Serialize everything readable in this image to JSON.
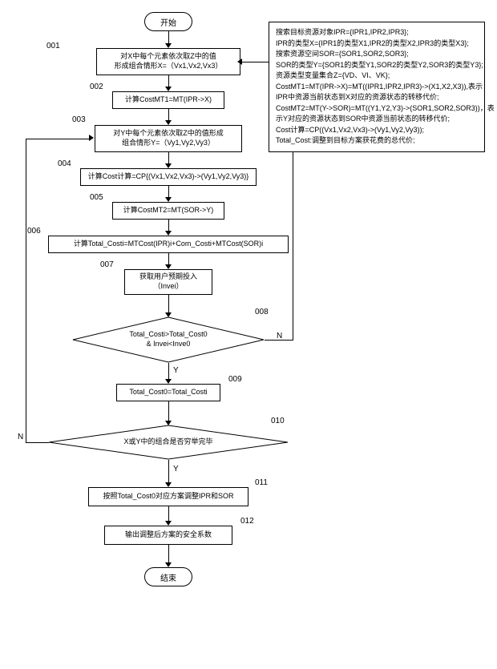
{
  "terminator": {
    "start": "开始",
    "end": "结束"
  },
  "steps": {
    "s001": {
      "num": "001",
      "text": "对X中每个元素依次取Z中的值\n形成组合情形X=（Vx1,Vx2,Vx3）"
    },
    "s002": {
      "num": "002",
      "text": "计算CostMT1=MT(IPR->X)"
    },
    "s003": {
      "num": "003",
      "text": "对Y中每个元素依次取Z中的值形成\n组合情形Y=（Vy1,Vy2,Vy3）"
    },
    "s004": {
      "num": "004",
      "text": "计算Cost计算=CP{(Vx1,Vx2,Vx3)->(Vy1,Vy2,Vy3)}"
    },
    "s005": {
      "num": "005",
      "text": "计算CostMT2=MT(SOR->Y)"
    },
    "s006": {
      "num": "006",
      "text": "计算Total_Costi=MTCost(IPR)i+Com_Costi+MTCost(SOR)i"
    },
    "s007": {
      "num": "007",
      "text": "获取用户预期投入\n（Invei）"
    },
    "s008": {
      "num": "008",
      "text": "Total_Costi>Total_Cost0\n& Invei<Inve0"
    },
    "s009": {
      "num": "009",
      "text": "Total_Cost0=Total_Costi"
    },
    "s010": {
      "num": "010",
      "text": "X或Y中的组合是否穷举完毕"
    },
    "s011": {
      "num": "011",
      "text": "按照Total_Cost0对应方案调整IPR和SOR"
    },
    "s012": {
      "num": "012",
      "text": "输出调整后方案的安全系数"
    }
  },
  "branches": {
    "yes": "Y",
    "no": "N"
  },
  "legend": [
    "搜索目标资源对象IPR={IPR1,IPR2,IPR3};",
    "IPR的类型X={IPR1的类型X1,IPR2的类型X2,IPR3的类型X3};",
    "搜索资源空间SOR={SOR1,SOR2,SOR3};",
    "SOR的类型Y={SOR1的类型Y1,SOR2的类型Y2,SOR3的类型Y3};",
    "资源类型变量集合Z={VD、VI、VK};",
    "CostMT1=MT(IPR->X)=MT((IPR1,IPR2,IPR3)->(X1,X2,X3)),表示",
    "IPR中资源当前状态到X对应的资源状态的转移代价;",
    "CostMT2=MT(Y->SOR)=MT((Y1,Y2,Y3)->(SOR1,SOR2,SOR3))，表",
    "示Y对应的资源状态到SOR中资源当前状态的转移代价;",
    "Cost计算=CP((Vx1,Vx2,Vx3)->(Vy1,Vy2,Vy3));",
    "Total_Cost:调整到目标方案获花费的总代价;"
  ]
}
